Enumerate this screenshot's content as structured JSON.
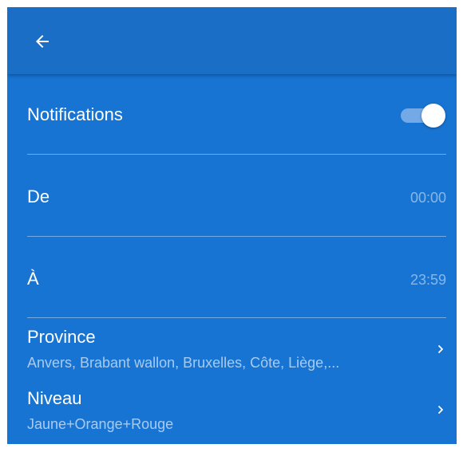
{
  "colors": {
    "appbar": "#1A6EC6",
    "background": "#1874D2",
    "toggle_track": "#72A9E6",
    "toggle_thumb": "#FFFFFF"
  },
  "header": {
    "back_icon": "arrow-left-icon"
  },
  "settings": {
    "notifications": {
      "label": "Notifications",
      "toggle_on": true
    },
    "from": {
      "label": "De",
      "value": "00:00"
    },
    "to": {
      "label": "À",
      "value": "23:59"
    },
    "province": {
      "label": "Province",
      "summary": "Anvers,  Brabant wallon,  Bruxelles,  Côte,  Liège,...",
      "icon": "chevron-right-icon"
    },
    "level": {
      "label": "Niveau",
      "summary": "Jaune+Orange+Rouge",
      "icon": "chevron-right-icon"
    }
  }
}
